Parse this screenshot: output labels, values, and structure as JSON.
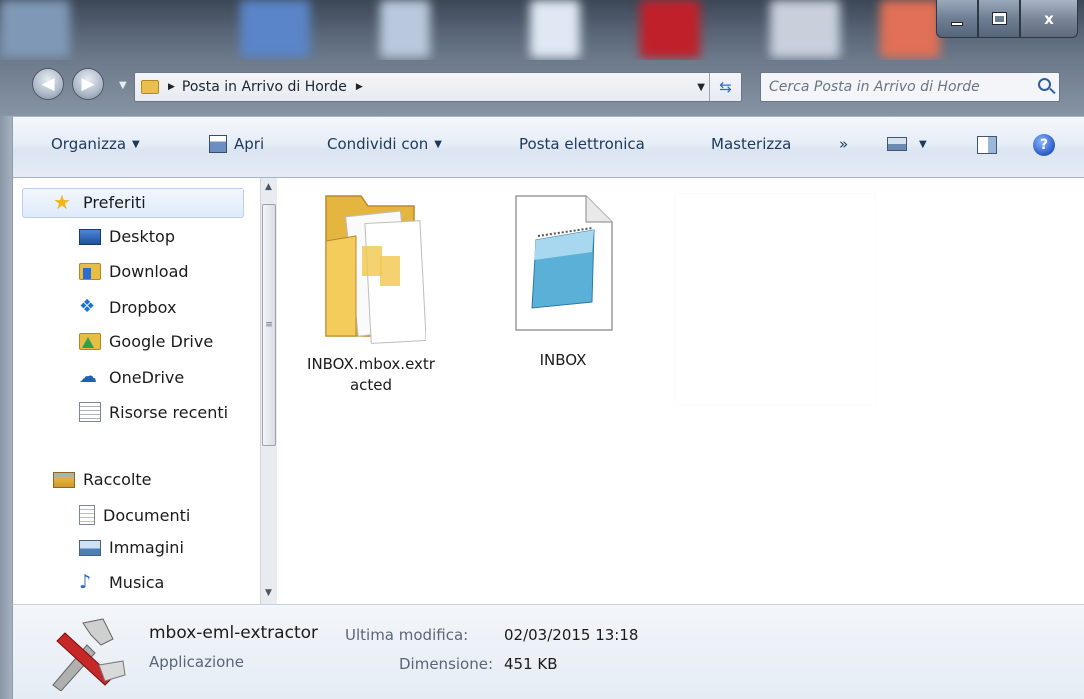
{
  "window": {
    "minimize_glyph": "",
    "maximize_glyph": "",
    "close_glyph": "x"
  },
  "address_bar": {
    "path": "Posta in Arrivo di Horde",
    "search_placeholder": "Cerca Posta in Arrivo di Horde"
  },
  "toolbar": {
    "organize": "Organizza",
    "open": "Apri",
    "share": "Condividi con",
    "email": "Posta elettronica",
    "burn": "Masterizza",
    "more": "»"
  },
  "nav_pane": {
    "favorites_header": "Preferiti",
    "favorites": [
      {
        "label": "Desktop",
        "icon": "desktop-icon"
      },
      {
        "label": "Download",
        "icon": "download-folder-icon"
      },
      {
        "label": "Dropbox",
        "icon": "dropbox-icon"
      },
      {
        "label": "Google Drive",
        "icon": "google-drive-icon"
      },
      {
        "label": "OneDrive",
        "icon": "onedrive-icon"
      },
      {
        "label": "Risorse recenti",
        "icon": "recent-places-icon"
      }
    ],
    "libraries_header": "Raccolte",
    "libraries": [
      {
        "label": "Documenti",
        "icon": "documents-icon"
      },
      {
        "label": "Immagini",
        "icon": "pictures-icon"
      },
      {
        "label": "Musica",
        "icon": "music-icon"
      }
    ]
  },
  "files": [
    {
      "name_line1": "INBOX.mbox.extr",
      "name_line2": "acted",
      "type": "folder"
    },
    {
      "name_line1": "INBOX",
      "type": "notepad-file"
    }
  ],
  "details": {
    "name": "mbox-eml-extractor",
    "type": "Applicazione",
    "modified_label": "Ultima modifica:",
    "modified_value": "02/03/2015 13:18",
    "size_label": "Dimensione:",
    "size_value": "451 KB"
  },
  "colors": {
    "accent": "#1e395b",
    "highlight": "#dfeafa",
    "folder": "#e8bd44"
  }
}
